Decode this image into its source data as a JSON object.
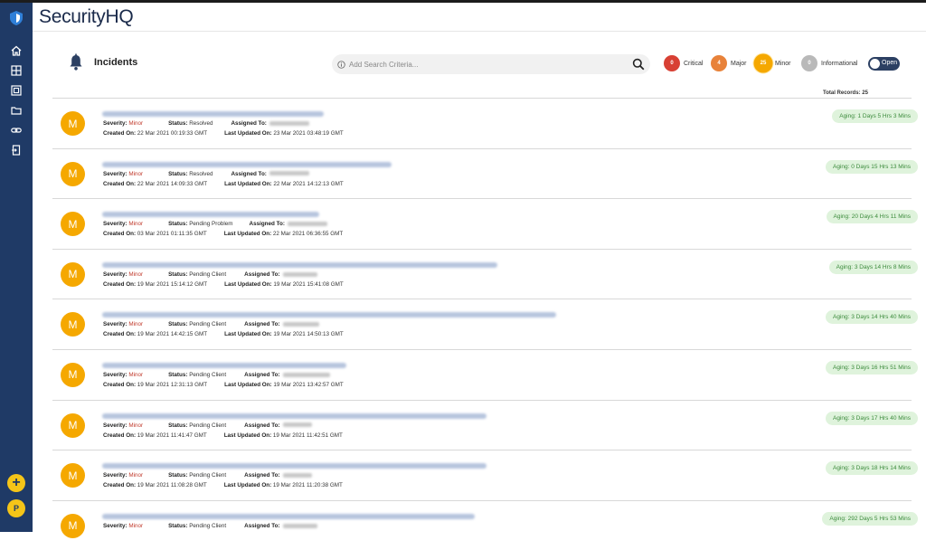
{
  "app": {
    "brand": "SecurityHQ"
  },
  "sidebar": {
    "items": [
      {
        "icon": "home-icon"
      },
      {
        "icon": "grid-icon"
      },
      {
        "icon": "dashboard-icon"
      },
      {
        "icon": "folder-icon"
      },
      {
        "icon": "link-icon"
      },
      {
        "icon": "logout-icon"
      }
    ],
    "add_label": "+",
    "user_initial": "P"
  },
  "page": {
    "title": "Incidents",
    "total_records": "Total Records: 25"
  },
  "search": {
    "placeholder": "Add Search Criteria..."
  },
  "severity": [
    {
      "label": "Critical",
      "count": "0",
      "color": "#d84034"
    },
    {
      "label": "Major",
      "count": "4",
      "color": "#e8823a"
    },
    {
      "label": "Minor",
      "count": "25",
      "color": "#f5a800"
    },
    {
      "label": "Informational",
      "count": "0",
      "color": "#b9b9b9"
    }
  ],
  "toggle": {
    "label": "Open"
  },
  "labels": {
    "severity": "Severity:",
    "status": "Status:",
    "assigned": "Assigned To:",
    "created": "Created On:",
    "updated": "Last Updated On:"
  },
  "incidents": [
    {
      "initial": "M",
      "severity": "Minor",
      "status": "Resolved",
      "created": "22 Mar 2021 00:19:33 GMT",
      "updated": "23 Mar 2021 03:48:19 GMT",
      "aging": "Aging: 1 Days 5 Hrs 3 Mins"
    },
    {
      "initial": "M",
      "severity": "Minor",
      "status": "Resolved",
      "created": "22 Mar 2021 14:09:33 GMT",
      "updated": "22 Mar 2021 14:12:13 GMT",
      "aging": "Aging: 0 Days 15 Hrs 13 Mins"
    },
    {
      "initial": "M",
      "severity": "Minor",
      "status": "Pending Problem",
      "created": "03 Mar 2021 01:11:35 GMT",
      "updated": "22 Mar 2021 06:36:55 GMT",
      "aging": "Aging: 20 Days 4 Hrs 11 Mins"
    },
    {
      "initial": "M",
      "severity": "Minor",
      "status": "Pending Client",
      "created": "19 Mar 2021 15:14:12 GMT",
      "updated": "19 Mar 2021 15:41:08 GMT",
      "aging": "Aging: 3 Days 14 Hrs 8 Mins"
    },
    {
      "initial": "M",
      "severity": "Minor",
      "status": "Pending Client",
      "created": "19 Mar 2021 14:42:15 GMT",
      "updated": "19 Mar 2021 14:50:13 GMT",
      "aging": "Aging: 3 Days 14 Hrs 40 Mins"
    },
    {
      "initial": "M",
      "severity": "Minor",
      "status": "Pending Client",
      "created": "19 Mar 2021 12:31:13 GMT",
      "updated": "19 Mar 2021 13:42:57 GMT",
      "aging": "Aging: 3 Days 16 Hrs 51 Mins"
    },
    {
      "initial": "M",
      "severity": "Minor",
      "status": "Pending Client",
      "created": "19 Mar 2021 11:41:47 GMT",
      "updated": "19 Mar 2021 11:42:51 GMT",
      "aging": "Aging: 3 Days 17 Hrs 40 Mins"
    },
    {
      "initial": "M",
      "severity": "Minor",
      "status": "Pending Client",
      "created": "19 Mar 2021 11:08:28 GMT",
      "updated": "19 Mar 2021 11:20:38 GMT",
      "aging": "Aging: 3 Days 18 Hrs 14 Mins"
    },
    {
      "initial": "M",
      "severity": "Minor",
      "status": "Pending Client",
      "created": "",
      "updated": "",
      "aging": "Aging: 292 Days 5 Hrs 53 Mins"
    }
  ]
}
